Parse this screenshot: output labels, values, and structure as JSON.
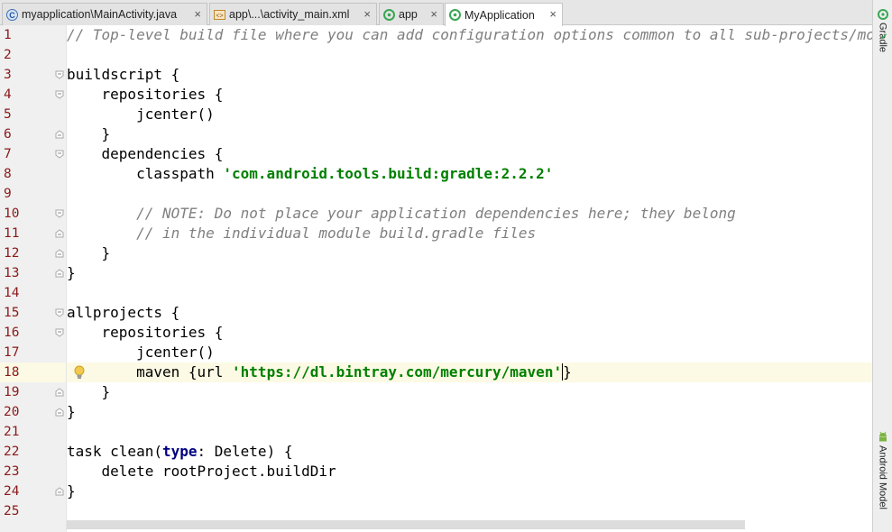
{
  "tabs": [
    {
      "label": "myapplication\\MainActivity.java",
      "icon": "java-class-icon",
      "active": false
    },
    {
      "label": "app\\...\\activity_main.xml",
      "icon": "xml-layout-icon",
      "active": false
    },
    {
      "label": "app",
      "icon": "gradle-module-icon",
      "active": false
    },
    {
      "label": "MyApplication",
      "icon": "gradle-module-icon",
      "active": true
    }
  ],
  "side_panels": {
    "gradle": "Gradle",
    "android_model": "Android Model"
  },
  "colors": {
    "comment": "#7f7f7f",
    "string": "#008000",
    "keyword": "#000080",
    "line_number": "#8b1a1a",
    "current_line": "#fcfae4"
  },
  "line_numbers": [
    "1",
    "2",
    "3",
    "4",
    "5",
    "6",
    "7",
    "8",
    "9",
    "10",
    "11",
    "12",
    "13",
    "14",
    "15",
    "16",
    "17",
    "18",
    "19",
    "20",
    "21",
    "22",
    "23",
    "24",
    "25"
  ],
  "code": {
    "l1": "// Top-level build file where you can add configuration options common to all sub-projects/modules.",
    "l3": "buildscript {",
    "l4": "    repositories {",
    "l5": "        jcenter()",
    "l6": "    }",
    "l7": "    dependencies {",
    "l8a": "        classpath ",
    "l8b": "'com.android.tools.build:gradle:2.2.2'",
    "l10": "        // NOTE: Do not place your application dependencies here; they belong",
    "l11": "        // in the individual module build.gradle files",
    "l12": "    }",
    "l13": "}",
    "l15": "allprojects {",
    "l16": "    repositories {",
    "l17": "        jcenter()",
    "l18a": "        maven {url ",
    "l18b": "'https://dl.bintray.com/mercury/maven'",
    "l18c": "}",
    "l19": "    }",
    "l20": "}",
    "l22a": "task clean(",
    "l22b": "type",
    "l22c": ": Delete) {",
    "l23": "    delete rootProject.buildDir",
    "l24": "}"
  }
}
